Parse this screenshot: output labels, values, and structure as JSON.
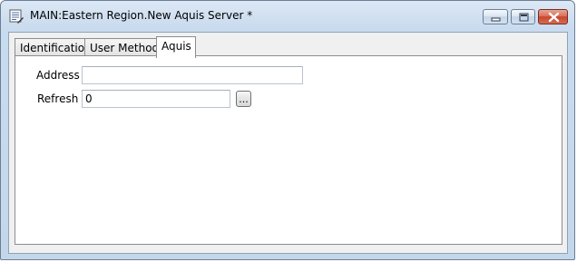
{
  "window": {
    "title": "MAIN:Eastern Region.New Aquis Server *"
  },
  "tabs": [
    {
      "label": "Identification",
      "selected": false
    },
    {
      "label": "User Methods",
      "selected": false
    },
    {
      "label": "Aquis",
      "selected": true
    }
  ],
  "form": {
    "address_label": "Address",
    "address_value": "",
    "refresh_label": "Refresh",
    "refresh_value": "0",
    "browse_label": "..."
  },
  "colors": {
    "title_bar": "#c9dbee",
    "close_button": "#c7452d",
    "panel_background": "#ffffff"
  },
  "icons": {
    "app": "server-properties-icon",
    "minimize": "minimize-icon",
    "maximize": "maximize-icon",
    "close": "close-icon"
  }
}
